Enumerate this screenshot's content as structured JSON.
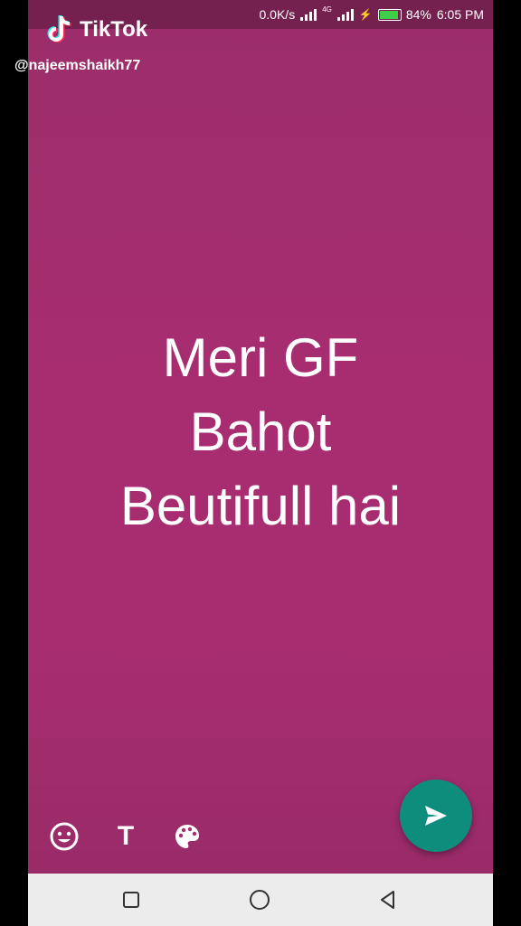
{
  "status_bar": {
    "speed": "0.0K/s",
    "network": "4G",
    "battery_percent": "84%",
    "time": "6:05 PM",
    "battery_color": "#3ecf4a"
  },
  "overlay": {
    "brand": "TikTok",
    "username": "@najeemshaikh77"
  },
  "status_message": {
    "lines": [
      "Meri GF",
      "Bahot",
      "Beutifull hai"
    ],
    "background_color": "#a72d70"
  },
  "toolbar": {
    "icons": [
      "emoji-icon",
      "text-icon",
      "palette-icon"
    ],
    "text_label": "T"
  },
  "send_button": {
    "icon": "send-icon",
    "color": "#0e8c7c"
  },
  "nav_bar": {
    "icons": [
      "recents-square-icon",
      "home-circle-icon",
      "back-triangle-icon"
    ]
  }
}
